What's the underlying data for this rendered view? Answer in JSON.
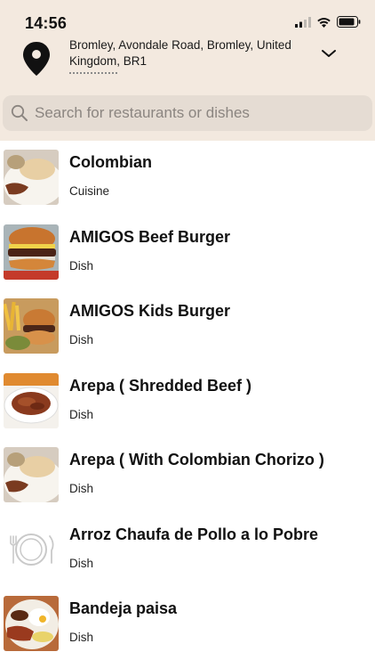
{
  "status": {
    "time": "14:56",
    "icons": [
      "signal-icon",
      "wifi-icon",
      "battery-icon"
    ]
  },
  "location": {
    "address": "Bromley, Avondale Road, Bromley, United Kingdom, BR1"
  },
  "search": {
    "placeholder": "Search for restaurants or dishes"
  },
  "colors": {
    "header_bg": "#f3e9df",
    "search_bg": "#e5dcd3",
    "placeholder": "#8b8580"
  },
  "results": [
    {
      "title": "Colombian",
      "type": "Cuisine",
      "image": "plate-arepa-image"
    },
    {
      "title": "AMIGOS Beef Burger",
      "type": "Dish",
      "image": "burger-image"
    },
    {
      "title": "AMIGOS Kids Burger",
      "type": "Dish",
      "image": "kids-burger-fries-image"
    },
    {
      "title": "Arepa ( Shredded Beef )",
      "type": "Dish",
      "image": "shredded-beef-image"
    },
    {
      "title": "Arepa ( With Colombian Chorizo )",
      "type": "Dish",
      "image": "arepa-chorizo-image"
    },
    {
      "title": "Arroz Chaufa de Pollo a lo Pobre",
      "type": "Dish",
      "image": "plate-cutlery-placeholder-icon"
    },
    {
      "title": "Bandeja paisa",
      "type": "Dish",
      "image": "bandeja-paisa-image"
    }
  ]
}
